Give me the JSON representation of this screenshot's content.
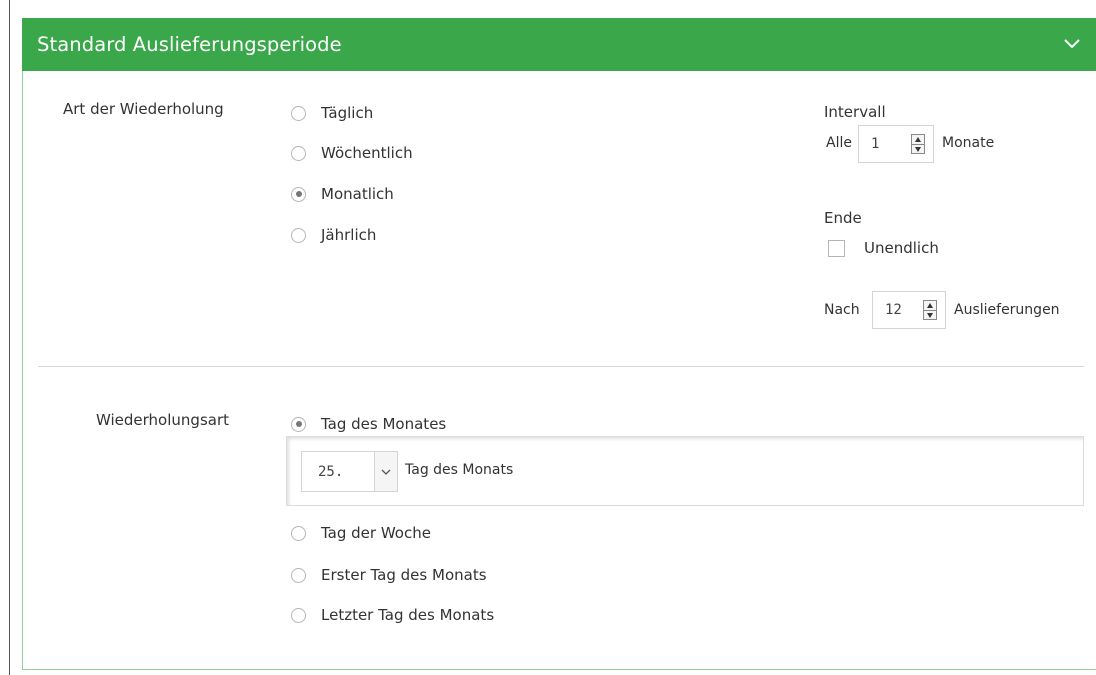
{
  "panel": {
    "title": "Standard Auslieferungsperiode",
    "chevron_icon": "chevron-down-icon",
    "header_color": "#3aa84a"
  },
  "repeat_type": {
    "label": "Art der Wiederholung",
    "options": [
      {
        "label": "Täglich",
        "checked": false
      },
      {
        "label": "Wöchentlich",
        "checked": false
      },
      {
        "label": "Monatlich",
        "checked": true
      },
      {
        "label": "Jährlich",
        "checked": false
      }
    ]
  },
  "interval": {
    "heading": "Intervall",
    "prefix": "Alle",
    "value": "1",
    "suffix": "Monate"
  },
  "end": {
    "heading": "Ende",
    "infinite_label": "Unendlich",
    "infinite_checked": false,
    "after_prefix": "Nach",
    "after_value": "12",
    "after_suffix": "Auslieferungen"
  },
  "repetition_mode": {
    "label": "Wiederholungsart",
    "day_of_month_label": "Tag des Monates",
    "day_of_month_checked": true,
    "day_select_value": "25.",
    "day_select_suffix": "Tag des Monats",
    "other_options": [
      {
        "label": "Tag der Woche",
        "checked": false
      },
      {
        "label": "Erster Tag des Monats",
        "checked": false
      },
      {
        "label": "Letzter Tag des Monats",
        "checked": false
      }
    ]
  }
}
